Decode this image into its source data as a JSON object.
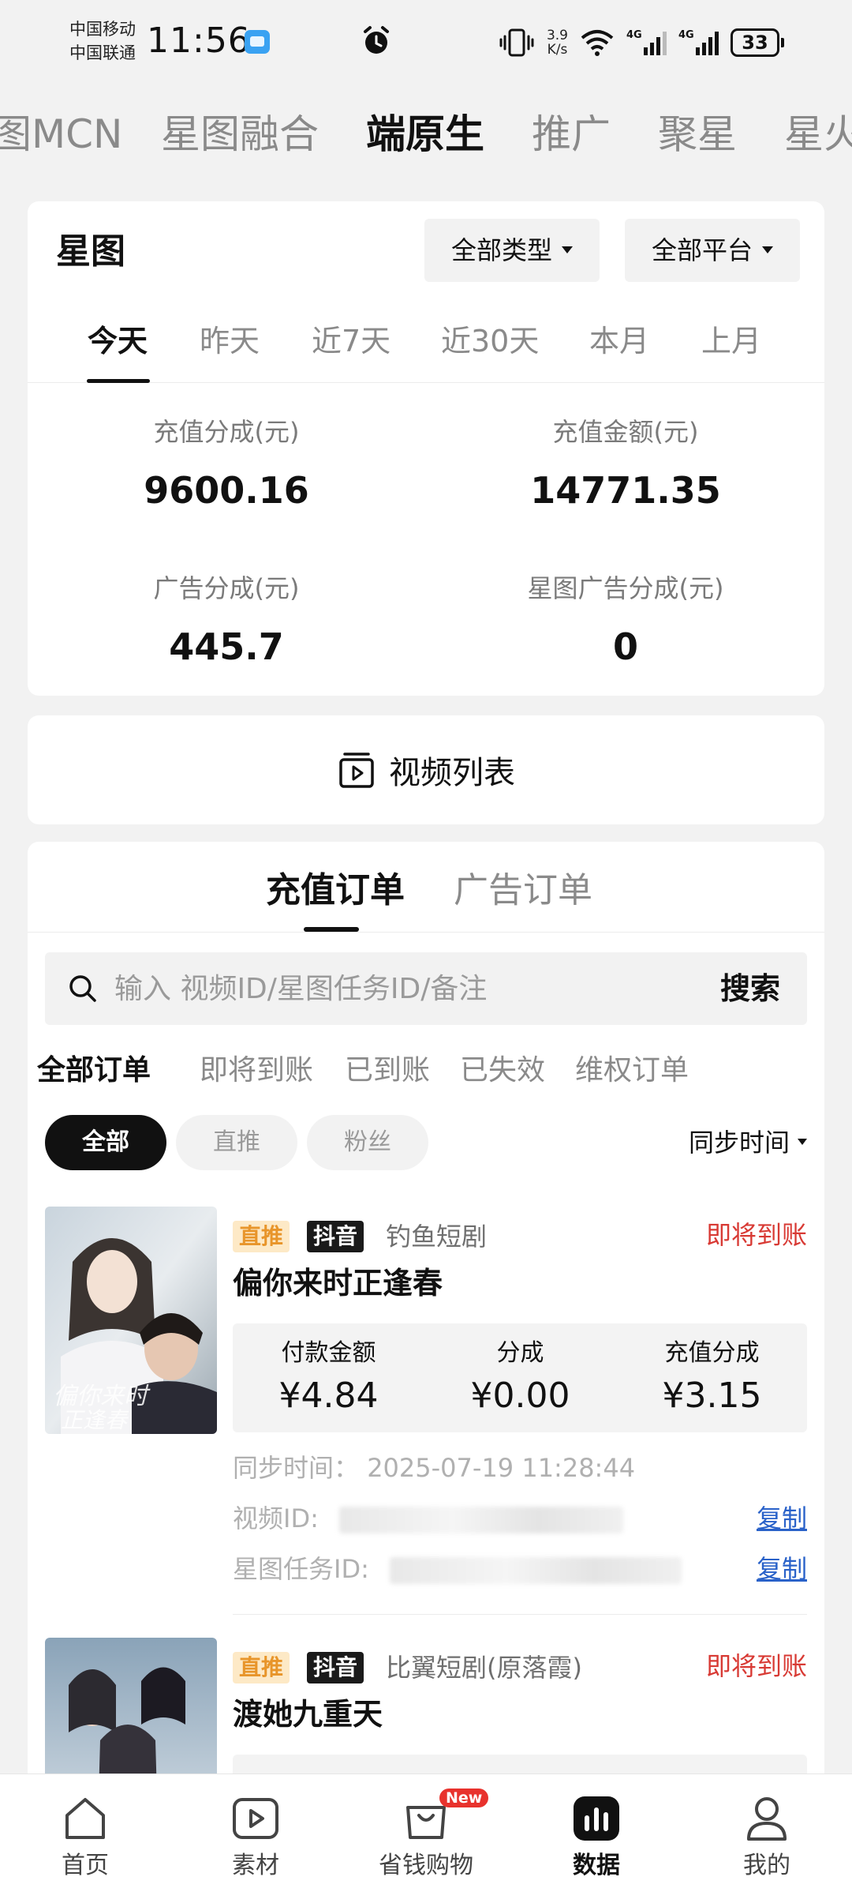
{
  "status_bar": {
    "carrier_1": "中国移动",
    "carrier_2": "中国联通",
    "time": "11:56",
    "net_speed_value": "3.9",
    "net_speed_unit": "K/s",
    "signal_1": "4G",
    "signal_2": "4G",
    "battery": "33"
  },
  "top_tabs": [
    {
      "label": "图MCN"
    },
    {
      "label": "星图融合"
    },
    {
      "label": "端原生",
      "active": true
    },
    {
      "label": "推广"
    },
    {
      "label": "聚星"
    },
    {
      "label": "星火"
    }
  ],
  "overview": {
    "title": "星图",
    "type_filter": "全部类型",
    "platform_filter": "全部平台",
    "date_tabs": [
      "今天",
      "昨天",
      "近7天",
      "近30天",
      "本月",
      "上月"
    ],
    "active_date_tab": "今天",
    "stats": [
      {
        "label": "充值分成(元)",
        "value": "9600.16"
      },
      {
        "label": "充值金额(元)",
        "value": "14771.35"
      },
      {
        "label": "广告分成(元)",
        "value": "445.7"
      },
      {
        "label": "星图广告分成(元)",
        "value": "0"
      }
    ]
  },
  "video_list": {
    "label": "视频列表"
  },
  "orders": {
    "tabs": [
      "充值订单",
      "广告订单"
    ],
    "active_tab": "充值订单",
    "search": {
      "placeholder": "输入 视频ID/星图任务ID/备注",
      "button": "搜索"
    },
    "status_filters": [
      "全部订单",
      "即将到账",
      "已到账",
      "已失效",
      "维权订单"
    ],
    "chips": [
      "全部",
      "直推",
      "粉丝"
    ],
    "sort_label": "同步时间",
    "items": [
      {
        "tag_type": "直推",
        "tag_platform": "抖音",
        "source": "钓鱼短剧",
        "status": "即将到账",
        "title": "偏你来时正逢春",
        "amount_labels": [
          "付款金额",
          "分成",
          "充值分成"
        ],
        "amounts": [
          "¥4.84",
          "¥0.00",
          "¥3.15"
        ],
        "sync_label": "同步时间：",
        "sync_time": "2025-07-19 11:28:44",
        "video_id_label": "视频ID:",
        "task_id_label": "星图任务ID:",
        "copy_label": "复制"
      },
      {
        "tag_type": "直推",
        "tag_platform": "抖音",
        "source": "比翼短剧(原落霞)",
        "status": "即将到账",
        "title": "渡她九重天"
      }
    ]
  },
  "bottom_nav": [
    {
      "label": "首页",
      "icon": "home-icon"
    },
    {
      "label": "素材",
      "icon": "play-icon"
    },
    {
      "label": "省钱购物",
      "icon": "shopping-bag-icon",
      "badge": "New"
    },
    {
      "label": "数据",
      "icon": "chart-icon",
      "active": true
    },
    {
      "label": "我的",
      "icon": "user-icon"
    }
  ],
  "colors": {
    "accent_red": "#d83a34",
    "tag_orange": "#e8952a",
    "link_blue": "#2a62c9",
    "badge_red": "#e8322d"
  }
}
